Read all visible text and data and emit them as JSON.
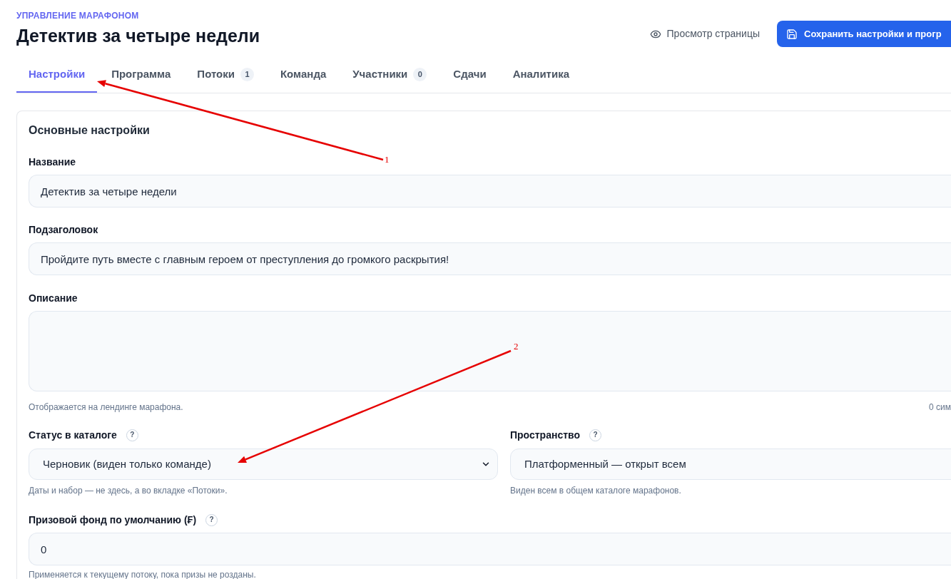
{
  "header": {
    "overline": "УПРАВЛЕНИЕ МАРАФОНОМ",
    "title": "Детектив за четыре недели",
    "preview_link": "Просмотр страницы",
    "save_button": "Сохранить настройки и прогр"
  },
  "tabs": [
    {
      "label": "Настройки",
      "selected": true
    },
    {
      "label": "Программа",
      "selected": false
    },
    {
      "label": "Потоки",
      "count": "1",
      "selected": false
    },
    {
      "label": "Команда",
      "selected": false
    },
    {
      "label": "Участники",
      "count": "0",
      "selected": false
    },
    {
      "label": "Сдачи",
      "selected": false
    },
    {
      "label": "Аналитика",
      "selected": false
    }
  ],
  "card": {
    "title": "Основные настройки",
    "rows": [
      {
        "fields": [
          {
            "kind": "input",
            "label": "Название",
            "value": "Детектив за четыре недели"
          }
        ]
      },
      {
        "fields": [
          {
            "kind": "input",
            "label": "Подзаголовок",
            "value": "Пройдите путь вместе с главным героем от преступления до громкого раскрытия!"
          }
        ]
      },
      {
        "fields": [
          {
            "kind": "textarea",
            "label": "Описание",
            "hint": "Отображается на лендинге марафона.",
            "counter": "0 сим"
          }
        ]
      },
      {
        "fields": [
          {
            "kind": "select",
            "label": "Статус в каталоге",
            "help": "?",
            "value": "Черновик (виден только команде)",
            "hint": "Даты и набор — не здесь, а во вкладке «Потоки»."
          },
          {
            "kind": "select",
            "label": "Пространство",
            "help": "?",
            "value": "Платформенный — открыт всем",
            "hint": "Виден всем в общем каталоге марафонов."
          }
        ]
      },
      {
        "fields": [
          {
            "kind": "input",
            "label": "Призовой фонд по умолчанию (₣)",
            "help": "?",
            "value": "0",
            "hint": "Применяется к текущему потоку, пока призы не розданы."
          }
        ]
      }
    ]
  },
  "annotations": [
    {
      "label": "1"
    },
    {
      "label": "2"
    }
  ]
}
